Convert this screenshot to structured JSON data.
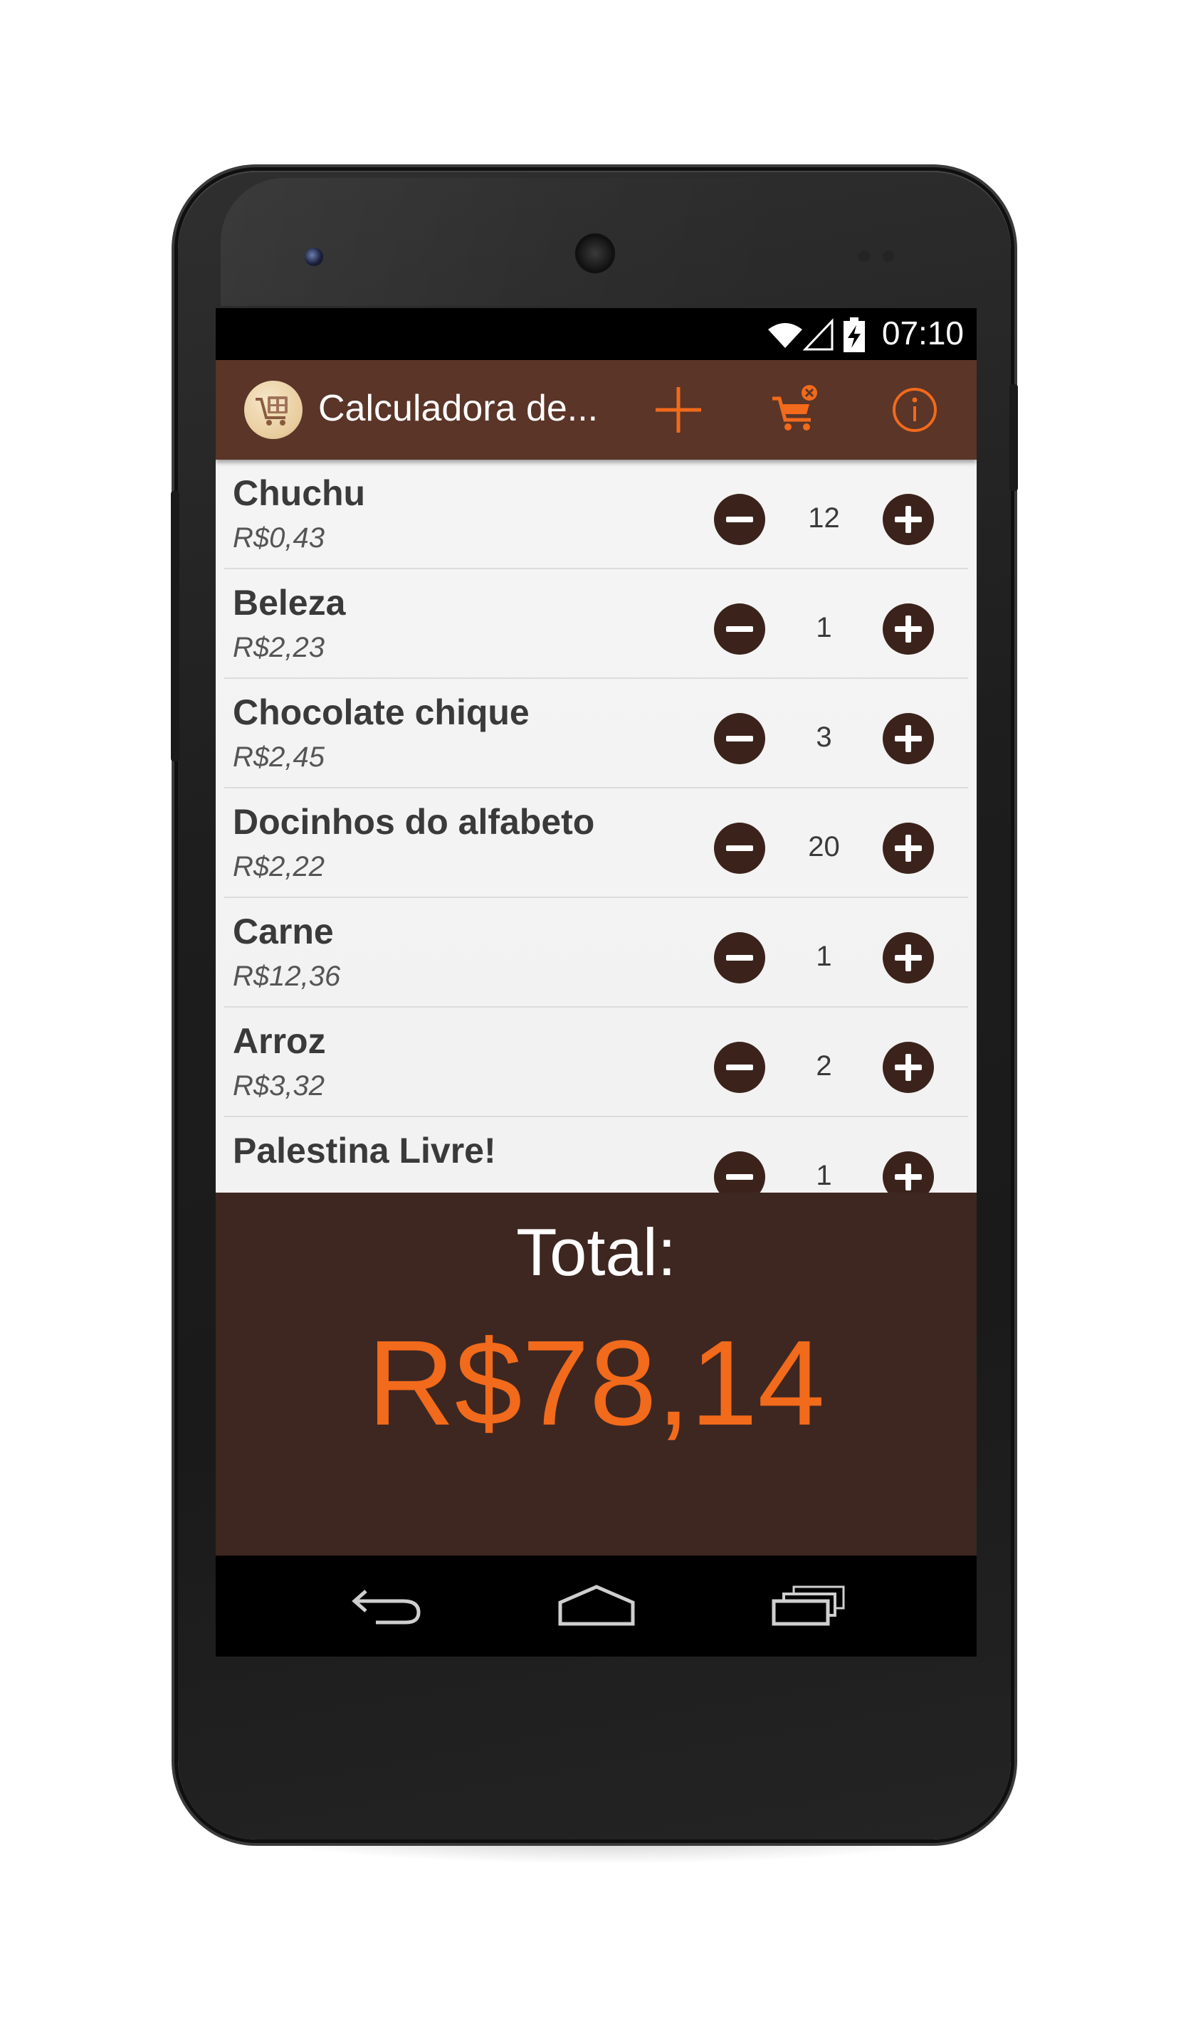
{
  "status_bar": {
    "time": "07:10",
    "icons": [
      "wifi-icon",
      "signal-icon",
      "battery-charging-icon"
    ]
  },
  "action_bar": {
    "title": "Calculadora de...",
    "logo_icon": "shopping-cart-calculator-icon",
    "actions": [
      {
        "name": "add-item-button",
        "icon": "plus-icon"
      },
      {
        "name": "clear-cart-button",
        "icon": "cart-remove-icon"
      },
      {
        "name": "info-button",
        "icon": "info-icon"
      }
    ],
    "accent_color": "#f26a1b",
    "background_color": "#5a3528"
  },
  "items": [
    {
      "name": "Chuchu",
      "price": "R$0,43",
      "qty": "12"
    },
    {
      "name": "Beleza",
      "price": "R$2,23",
      "qty": "1"
    },
    {
      "name": "Chocolate chique",
      "price": "R$2,45",
      "qty": "3"
    },
    {
      "name": "Docinhos do alfabeto",
      "price": "R$2,22",
      "qty": "20"
    },
    {
      "name": "Carne",
      "price": "R$12,36",
      "qty": "1"
    },
    {
      "name": "Arroz",
      "price": "R$3,32",
      "qty": "2"
    },
    {
      "name": "Palestina Livre!",
      "price": "",
      "qty": "1"
    }
  ],
  "total": {
    "label": "Total:",
    "value": "R$78,14",
    "panel_color": "#3e2721",
    "value_color": "#f26a1b"
  },
  "nav_bar": {
    "buttons": [
      "back-icon",
      "home-icon",
      "recent-apps-icon"
    ]
  }
}
